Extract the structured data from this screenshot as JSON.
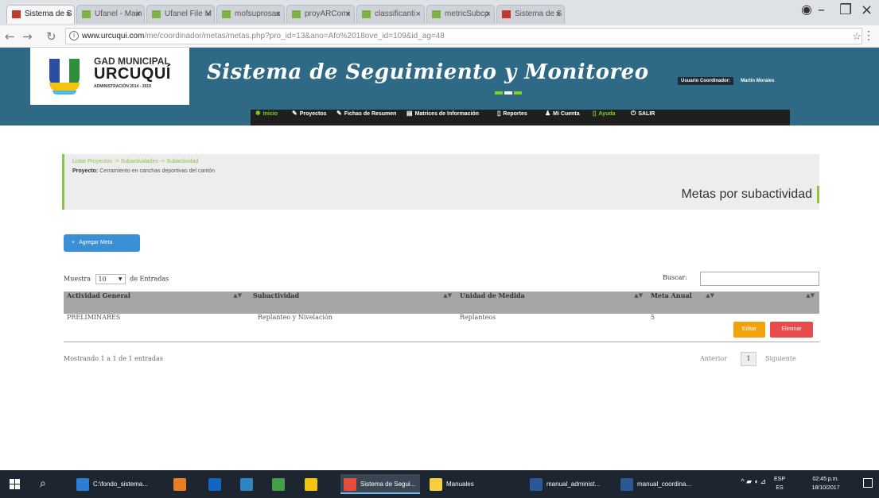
{
  "browser": {
    "tabs": [
      {
        "label": "Sistema de S",
        "active": true,
        "favicon_color": "#c0392b"
      },
      {
        "label": "Ufanel - Main",
        "active": false,
        "favicon_color": "#7cb342"
      },
      {
        "label": "Ufanel File M",
        "active": false,
        "favicon_color": "#7cb342"
      },
      {
        "label": "mofsuprosac",
        "active": false,
        "favicon_color": "#7cb342"
      },
      {
        "label": "proyARComi",
        "active": false,
        "favicon_color": "#7cb342"
      },
      {
        "label": "classificanti",
        "active": false,
        "favicon_color": "#7cb342"
      },
      {
        "label": "metricSubcp",
        "active": false,
        "favicon_color": "#7cb342"
      },
      {
        "label": "Sistema de S",
        "active": false,
        "favicon_color": "#c0392b"
      }
    ],
    "url_host": "www.urcuqui.com",
    "url_rest": "/me/coordinador/metas/metas.php?pro_id=13&ano=Afo%2018ove_id=109&id_ag=48"
  },
  "header": {
    "logo_line1": "GAD MUNICIPAL",
    "logo_line2": "URCUQUÍ",
    "logo_line3": "ADMINISTRACIÓN 2014 - 2019",
    "app_title": "Sistema de Seguimiento y Monitoreo",
    "user_label": "Usuario Coordinador:",
    "user_name": "Martin Morales",
    "brand_colors": {
      "blue": "#2a4fa0",
      "green": "#2f8f3a",
      "yellow": "#f2c30f",
      "cyan": "#4fb8e0"
    }
  },
  "menu": {
    "items": [
      {
        "label": "Inicio",
        "icon": "home-icon",
        "glyph": "✱",
        "highlight": true
      },
      {
        "label": "Proyectos",
        "icon": "pencil-icon",
        "glyph": "✎",
        "highlight": false
      },
      {
        "label": "Fichas de Resumen",
        "icon": "pencil-icon",
        "glyph": "✎",
        "highlight": false
      },
      {
        "label": "Matrices de Información",
        "icon": "grid-icon",
        "glyph": "▤",
        "highlight": false
      },
      {
        "label": "Reportes",
        "icon": "document-icon",
        "glyph": "▯",
        "highlight": false
      },
      {
        "label": "Mi Cuenta",
        "icon": "user-icon",
        "glyph": "♟",
        "highlight": false
      },
      {
        "label": "Ayuda",
        "icon": "document-icon",
        "glyph": "▯",
        "highlight": true
      },
      {
        "label": "SALIR",
        "icon": "power-icon",
        "glyph": "⏻",
        "highlight": false
      }
    ]
  },
  "panel": {
    "breadcrumb": "Listar Proyectos -> Subactividades -> Subactividad",
    "project_label": "Proyecto:",
    "project_name": "Cerramiento en canchas deportivas del cantón",
    "title": "Metas por subactividad"
  },
  "actions": {
    "add_label": "Agregar Meta"
  },
  "table_controls": {
    "show_prefix": "Muestra",
    "page_size": "10",
    "show_suffix": "de Entradas",
    "search_label": "Buscar:",
    "search_value": ""
  },
  "table": {
    "columns": [
      "Actividad General",
      "Subactividad",
      "Unidad de Medida",
      "Meta Anual",
      ""
    ],
    "rows": [
      {
        "actividad": "PRELIMINARES",
        "subactividad": "Replanteo y Nivelación",
        "unidad": "Replanteos",
        "meta": "5",
        "edit_label": "Editar",
        "delete_label": "Eliminar"
      }
    ],
    "info": "Mostrando 1 a 1 de 1 entradas",
    "pager": {
      "prev": "Anterior",
      "page": "1",
      "next": "Siguiente"
    }
  },
  "taskbar": {
    "apps": [
      {
        "label": "C:\\fondo_sistema...",
        "color": "#2d7dd2"
      },
      {
        "label": "",
        "color": "#e67e22"
      },
      {
        "label": "",
        "color": "#1565c0"
      },
      {
        "label": "",
        "color": "#2e86c1"
      },
      {
        "label": "",
        "color": "#43a047"
      },
      {
        "label": "",
        "color": "#f1c40f"
      },
      {
        "label": "Sistema de Segui...",
        "color": "#e74c3c"
      },
      {
        "label": "Manuales",
        "color": "#f4d03f"
      },
      {
        "label": "manual_administ...",
        "color": "#2b5797"
      },
      {
        "label": "manual_coordina...",
        "color": "#2b5797"
      }
    ],
    "lang_top": "ESP",
    "lang_bottom": "ES",
    "time": "02:45 p.m.",
    "date": "18/10/2017"
  }
}
